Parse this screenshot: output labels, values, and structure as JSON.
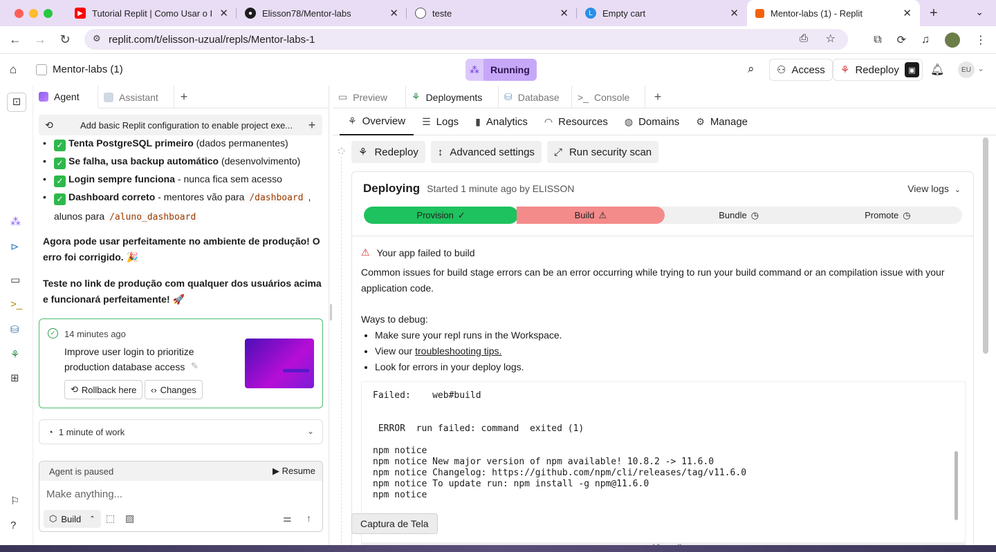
{
  "browser": {
    "tabs": [
      {
        "title": "Tutorial Replit | Como Usar o I",
        "favicon": "youtube-icon",
        "color": "#ff0000"
      },
      {
        "title": "Elisson78/Mentor-labs",
        "favicon": "github-icon",
        "color": "#1c1c1c"
      },
      {
        "title": "teste",
        "favicon": "globe-icon",
        "color": "#666666"
      },
      {
        "title": "Empty cart",
        "favicon": "l-logo-icon",
        "color": "#2b8fe8"
      },
      {
        "title": "Mentor-labs (1) - Replit",
        "favicon": "replit-icon",
        "color": "#f26207"
      }
    ],
    "url": "replit.com/t/elisson-uzual/repls/Mentor-labs-1"
  },
  "header": {
    "project_name": "Mentor-labs (1)",
    "status": "Running",
    "access_label": "Access",
    "redeploy_label": "Redeploy",
    "user_initials": "EU"
  },
  "left_panel": {
    "tabs": [
      "Agent",
      "Assistant"
    ],
    "history_title": "Add basic Replit configuration to enable project exe...",
    "bullets": [
      {
        "bold": "Tenta PostgreSQL primeiro",
        "rest": " (dados permanentes)"
      },
      {
        "bold": "Se falha, usa backup automático",
        "rest": " (desenvolvimento)"
      },
      {
        "bold": "Login sempre funciona",
        "rest": " - nunca fica sem acesso"
      }
    ],
    "bullet4_bold": "Dashboard correto",
    "bullet4_mid": " - mentores vão para ",
    "bullet4_code1": "/dashboard",
    "bullet4_sep": " ,",
    "bullet4_line2": "alunos para ",
    "bullet4_code2": "/aluno_dashboard",
    "para1": "Agora pode usar perfeitamente no ambiente de produção! O erro foi corrigido. 🎉",
    "para2": "Teste no link de produção com qualquer dos usuários acima e funcionará perfeitamente! 🚀",
    "checkpoint": {
      "time": "14 minutes ago",
      "description": "Improve user login to prioritize production database access",
      "rollback_label": "Rollback here",
      "changes_label": "Changes"
    },
    "work_label": "1 minute of work",
    "paused_label": "Agent is paused",
    "resume_label": "Resume",
    "prompt_placeholder": "Make anything...",
    "build_label": "Build"
  },
  "right_panel": {
    "tabs": [
      "Preview",
      "Deployments",
      "Database",
      "Console"
    ],
    "subnav": [
      "Overview",
      "Logs",
      "Analytics",
      "Resources",
      "Domains",
      "Manage"
    ],
    "actions": [
      "Redeploy",
      "Advanced settings",
      "Run security scan"
    ],
    "deploy": {
      "status": "Deploying",
      "started": "Started 1 minute ago by ELISSON",
      "view_logs": "View logs",
      "steps": [
        {
          "label": "Provision",
          "state": "done",
          "color": "#1ec25e"
        },
        {
          "label": "Build",
          "state": "failed",
          "color": "#f48b8b"
        },
        {
          "label": "Bundle",
          "state": "pending",
          "color": "#f0f0f0"
        },
        {
          "label": "Promote",
          "state": "pending",
          "color": "#f0f0f0"
        }
      ],
      "error_title": "Your app failed to build",
      "error_desc": "Common issues for build stage errors can be an error occurring while trying to run your build command or an compilation issue with your application code.",
      "debug_heading": "Ways to debug:",
      "debug_1": "Make sure your repl runs in the Workspace.",
      "debug_2_prefix": "View our ",
      "debug_2_link": "troubleshooting tips.",
      "debug_3": "Look for errors in your deploy logs.",
      "log": "Failed:    web#build\n\n\n ERROR  run failed: command  exited (1)\n\nnpm notice\nnpm notice New major version of npm available! 10.8.2 -> 11.6.0\nnpm notice Changelog: https://github.com/npm/cli/releases/tag/v11.6.0\nnpm notice To update run: npm install -g npm@11.6.0\nnpm notice",
      "view_all": "View all"
    }
  },
  "tooltip": "Captura de Tela"
}
